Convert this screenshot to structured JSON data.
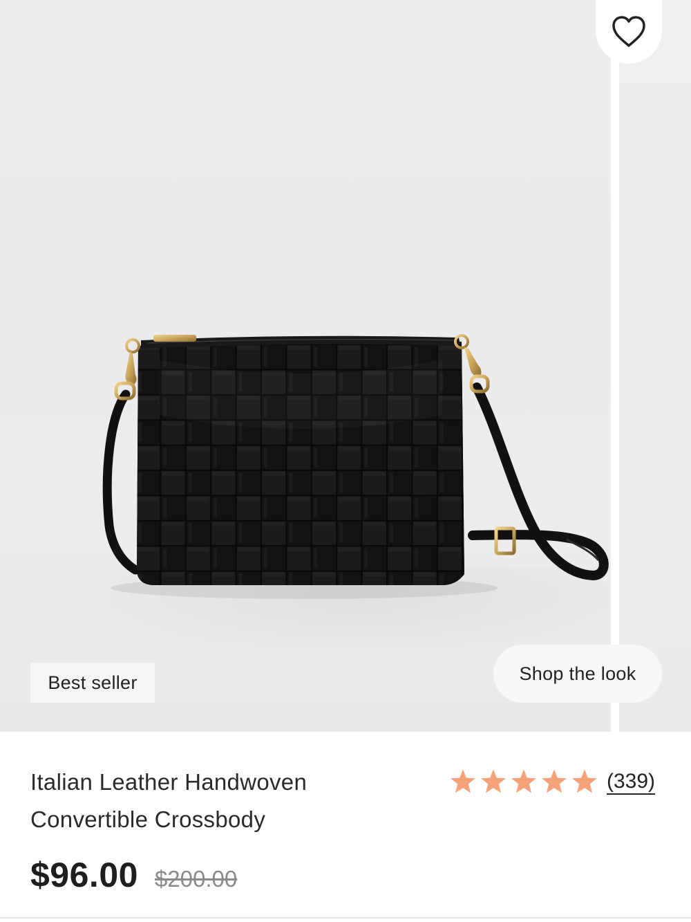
{
  "product": {
    "badge": "Best seller",
    "shop_the_look": "Shop the look",
    "title_line1": "Italian Leather Handwoven",
    "title_line2": "Convertible Crossbody",
    "price": "$96.00",
    "original_price": "$200.00",
    "rating": {
      "stars": 5,
      "review_count": "(339)",
      "star_color": "#f5a27a"
    }
  },
  "icons": {
    "favorite": "heart-outline-icon",
    "star": "star-icon"
  },
  "colors": {
    "image_background": "#ececee",
    "bag": "#151515",
    "hardware": "#c9a45c"
  }
}
